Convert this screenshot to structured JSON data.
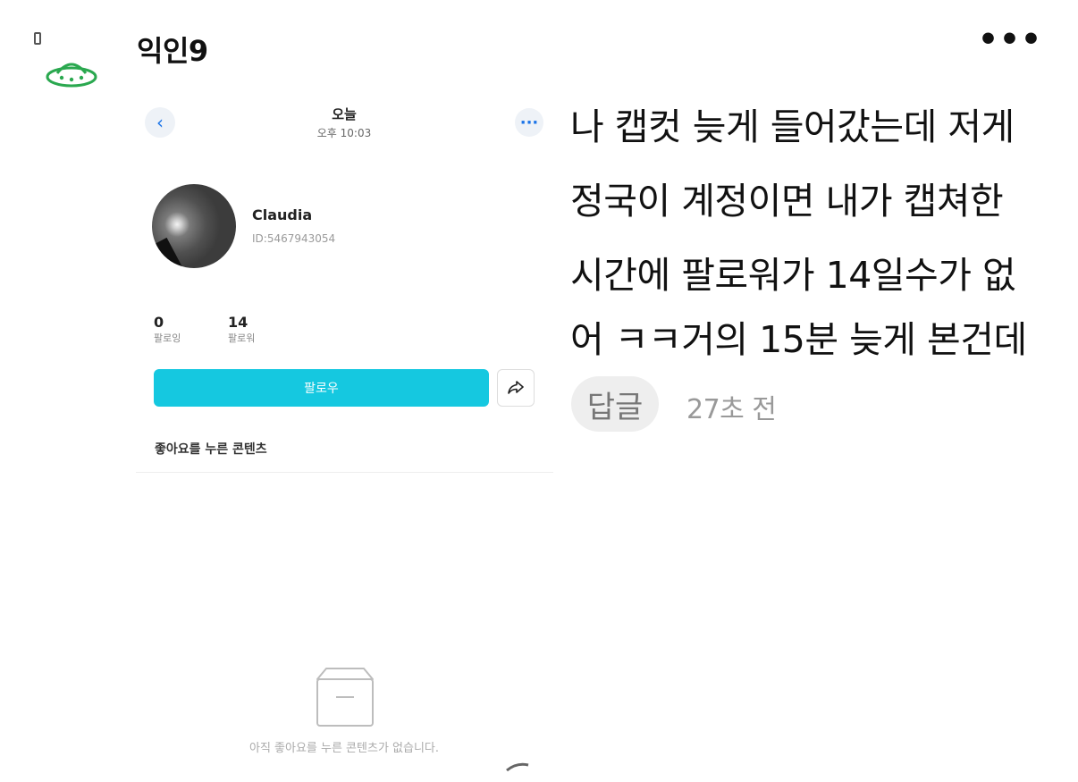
{
  "comment": {
    "author": "익인9",
    "author_icon": "ufo-icon",
    "more_icon": "more-horizontal-icon",
    "more_label": "•••",
    "lines": [
      "나 캡컷 늦게 들어갔는데 저게",
      "정국이 계정이면 내가 캡쳐한",
      "시간에 팔로워가 14일수가 없",
      "어 ㅋㅋ거의 15분 늦게 본건데"
    ],
    "reply_label": "답글",
    "time": "27초 전"
  },
  "embedded_screen": {
    "header": {
      "back_icon": "chevron-left-icon",
      "back_label": "‹",
      "title": "오늘",
      "time": "오후 10:03",
      "more_icon": "more-horizontal-icon",
      "more_label": "···"
    },
    "profile": {
      "name": "Claudia",
      "id": "ID:5467943054"
    },
    "stats": [
      {
        "value": "0",
        "label": "팔로잉"
      },
      {
        "value": "14",
        "label": "팔로워"
      }
    ],
    "follow_label": "팔로우",
    "share_icon": "share-arrow-icon",
    "section_title": "좋아요를 누른 콘텐츠",
    "empty_icon": "empty-box-icon",
    "empty_text": "아직 좋아요를 누른 콘텐츠가 없습니다."
  },
  "colors": {
    "accent_button": "#15c8e0",
    "link_blue": "#1a73e8",
    "ufo_green": "#2aa84f"
  }
}
